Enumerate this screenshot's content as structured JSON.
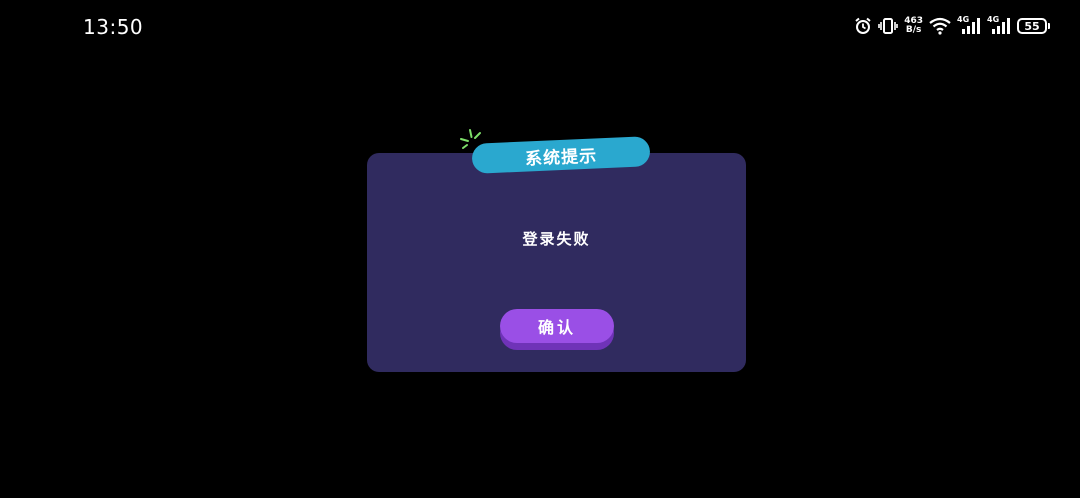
{
  "status_bar": {
    "time": "13:50",
    "net_speed_value": "463",
    "net_speed_unit": "B/s",
    "signal1_label": "4G",
    "signal2_label": "4G",
    "battery_level": "55",
    "icons": [
      "alarm-icon",
      "vibrate-icon",
      "wifi-icon",
      "cell-signal-icon",
      "cell-signal-icon",
      "battery-icon"
    ]
  },
  "dialog": {
    "title": "系统提示",
    "message": "登录失败",
    "confirm_label": "确认",
    "colors": {
      "background": "#302b5f",
      "title_badge": "#2aa8cf",
      "button": "#9a4fe6",
      "sparkle": "#7ee06a"
    }
  }
}
